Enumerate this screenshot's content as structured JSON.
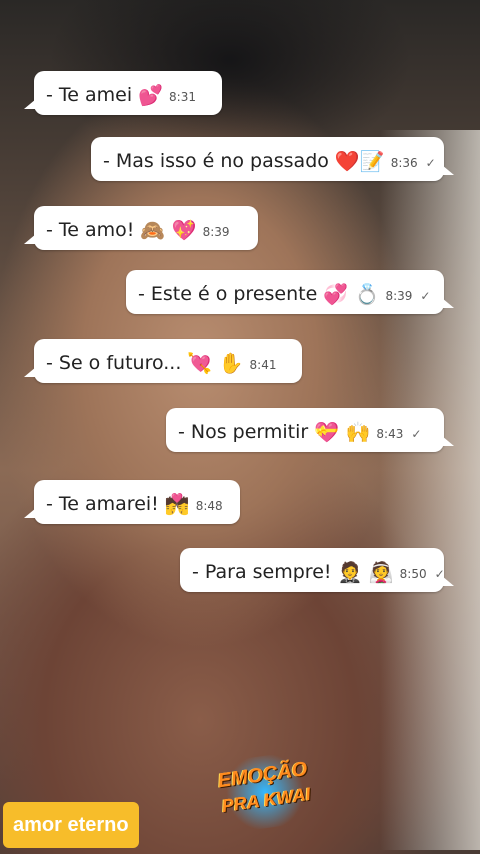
{
  "messages": [
    {
      "text": "- Te amei",
      "emoji": "💕",
      "time": "8:31",
      "tick": ""
    },
    {
      "text": "- Mas isso é no passado",
      "emoji": "❤️📝",
      "time": "8:36",
      "tick": "✓"
    },
    {
      "text": "-  Te amo!",
      "emoji": "🙈 💖",
      "time": "8:39",
      "tick": ""
    },
    {
      "text": "- Este é o presente",
      "emoji": "💞 💍",
      "time": "8:39",
      "tick": "✓"
    },
    {
      "text": "- Se o futuro...",
      "emoji": "💘 ✋",
      "time": "8:41",
      "tick": ""
    },
    {
      "text": "-  Nos permitir",
      "emoji": "💝 🙌",
      "time": "8:43",
      "tick": "✓"
    },
    {
      "text": "- Te amarei!",
      "emoji": "💏",
      "time": "8:48",
      "tick": ""
    },
    {
      "text": "- Para sempre!",
      "emoji": "🤵 👰",
      "time": "8:50",
      "tick": "✓"
    }
  ],
  "caption_tag": "amor eterno",
  "watermark": {
    "line1": "EMOÇÃO",
    "line2": "PRA KWAI"
  },
  "colors": {
    "bubble": "#ffffff",
    "tag": "#f7bd2a",
    "logo_text": "#ff8a1e"
  }
}
